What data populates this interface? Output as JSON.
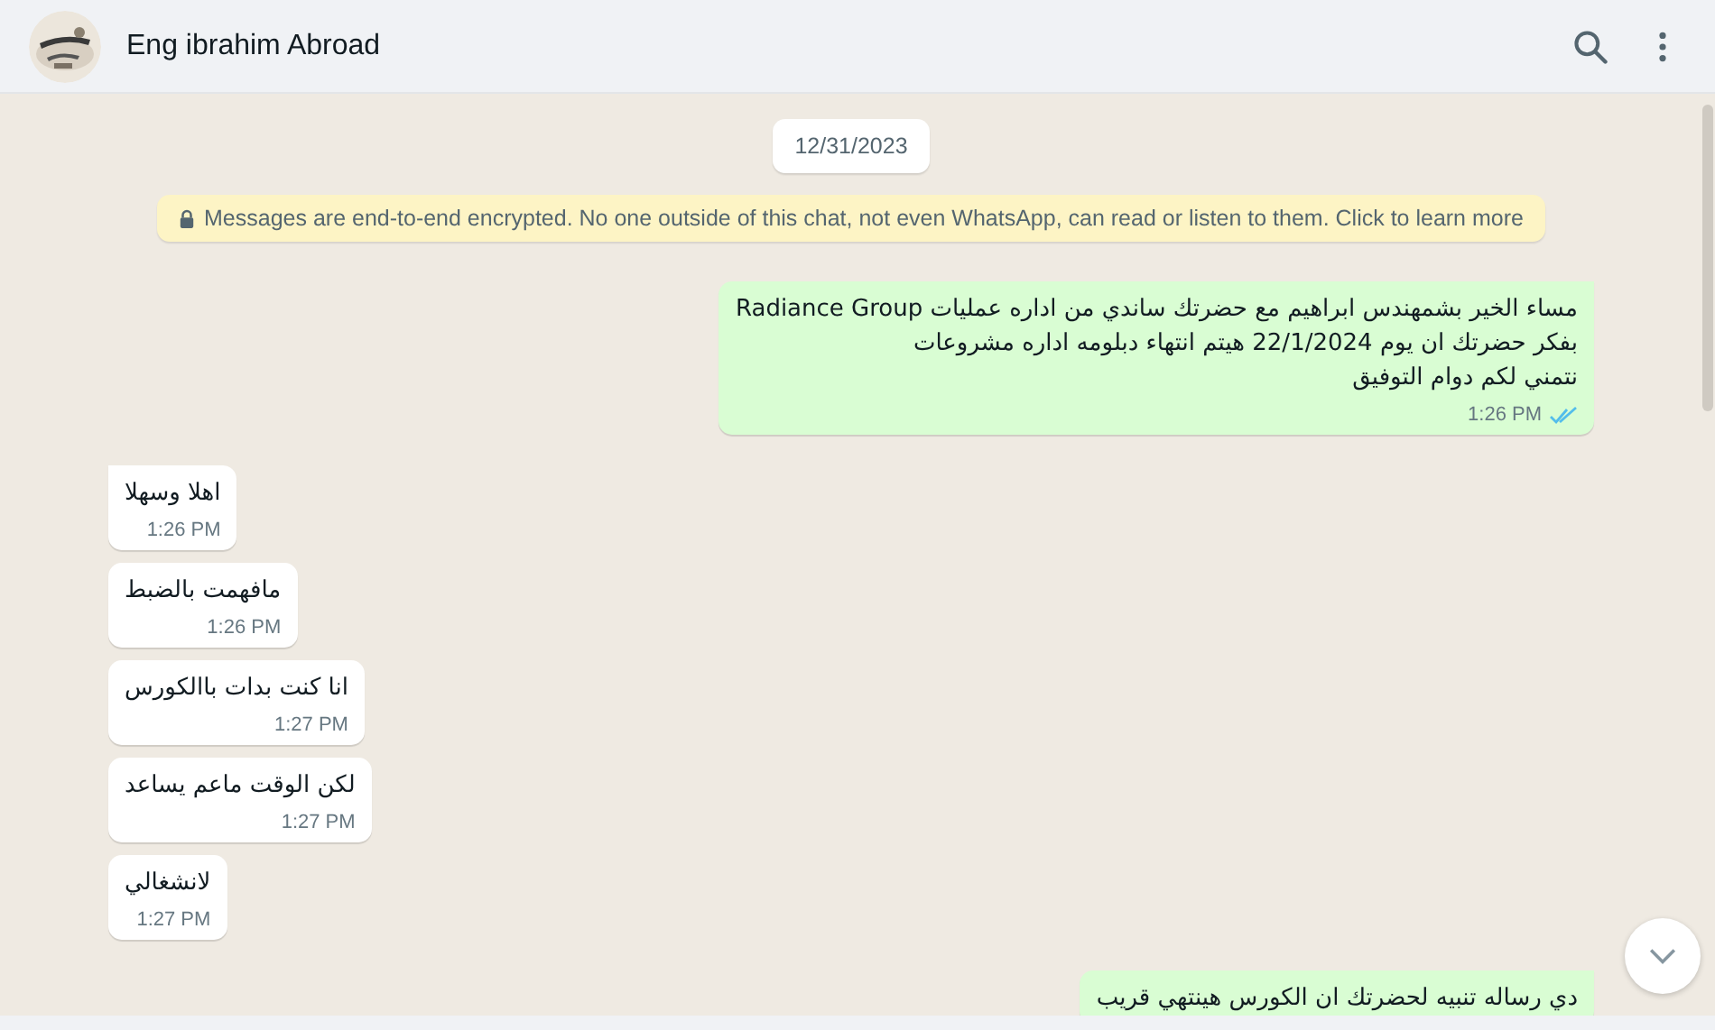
{
  "header": {
    "contact_name": "Eng ibrahim Abroad"
  },
  "date_chip": "12/31/2023",
  "encryption_notice": "Messages are end-to-end encrypted. No one outside of this chat, not even WhatsApp, can read or listen to them. Click to learn more",
  "messages": [
    {
      "kind": "outgoing",
      "text": "مساء الخير بشمهندس ابراهيم مع حضرتك ساندي من اداره عمليات Radiance Group\nبفكر حضرتك ان يوم 22/1/2024 هيتم انتهاء دبلومه اداره مشروعات\nنتمني لكم دوام التوفيق",
      "time": "1:26 PM",
      "read": true,
      "tail": true
    },
    {
      "kind": "incoming",
      "text": "اهلا وسهلا",
      "time": "1:26 PM",
      "tail": true
    },
    {
      "kind": "incoming",
      "text": "مافهمت بالضبط",
      "time": "1:26 PM",
      "tail": false
    },
    {
      "kind": "incoming",
      "text": "انا كنت بدات باالكورس",
      "time": "1:27 PM",
      "tail": false
    },
    {
      "kind": "incoming",
      "text": "لكن الوقت ماعم يساعد",
      "time": "1:27 PM",
      "tail": false
    },
    {
      "kind": "incoming",
      "text": "لانشغالي",
      "time": "1:27 PM",
      "tail": false
    },
    {
      "kind": "outgoing",
      "text": "دي رساله تنبيه لحضرتك ان الكورس هينتهي قريب",
      "tail": true
    }
  ]
}
